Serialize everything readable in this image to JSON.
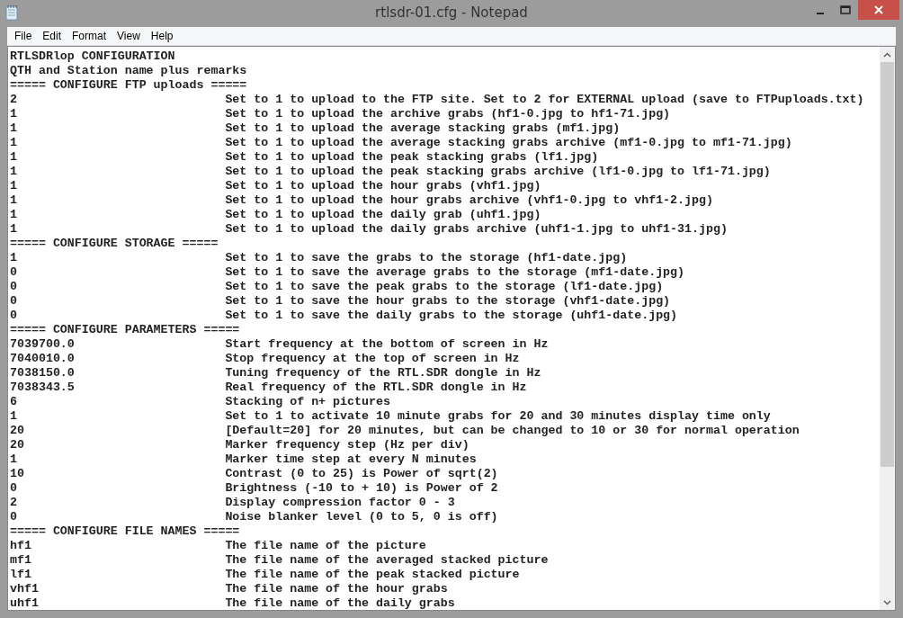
{
  "window": {
    "title": "rtlsdr-01.cfg - Notepad"
  },
  "menu": [
    "File",
    "Edit",
    "Format",
    "View",
    "Help"
  ],
  "lines": [
    {
      "kind": "text",
      "text": "RTLSDRlop CONFIGURATION"
    },
    {
      "kind": "text",
      "text": "QTH and Station name plus remarks"
    },
    {
      "kind": "text",
      "text": "===== CONFIGURE FTP uploads ====="
    },
    {
      "kind": "setting",
      "value": "2",
      "description": "Set to 1 to upload to the FTP site. Set to 2 for EXTERNAL upload (save to FTPuploads.txt)"
    },
    {
      "kind": "setting",
      "value": "1",
      "description": "Set to 1 to upload the archive grabs (hf1-0.jpg to hf1-71.jpg)"
    },
    {
      "kind": "setting",
      "value": "1",
      "description": "Set to 1 to upload the average stacking grabs (mf1.jpg)"
    },
    {
      "kind": "setting",
      "value": "1",
      "description": "Set to 1 to upload the average stacking grabs archive (mf1-0.jpg to mf1-71.jpg)"
    },
    {
      "kind": "setting",
      "value": "1",
      "description": "Set to 1 to upload the peak stacking grabs (lf1.jpg)"
    },
    {
      "kind": "setting",
      "value": "1",
      "description": "Set to 1 to upload the peak stacking grabs archive (lf1-0.jpg to lf1-71.jpg)"
    },
    {
      "kind": "setting",
      "value": "1",
      "description": "Set to 1 to upload the hour grabs (vhf1.jpg)"
    },
    {
      "kind": "setting",
      "value": "1",
      "description": "Set to 1 to upload the hour grabs archive (vhf1-0.jpg to vhf1-2.jpg)"
    },
    {
      "kind": "setting",
      "value": "1",
      "description": "Set to 1 to upload the daily grab (uhf1.jpg)"
    },
    {
      "kind": "setting",
      "value": "1",
      "description": "Set to 1 to upload the daily grabs archive (uhf1-1.jpg to uhf1-31.jpg)"
    },
    {
      "kind": "text",
      "text": "===== CONFIGURE STORAGE ====="
    },
    {
      "kind": "setting",
      "value": "1",
      "description": "Set to 1 to save the grabs to the storage (hf1-date.jpg)"
    },
    {
      "kind": "setting",
      "value": "0",
      "description": "Set to 1 to save the average grabs to the storage (mf1-date.jpg)"
    },
    {
      "kind": "setting",
      "value": "0",
      "description": "Set to 1 to save the peak grabs to the storage (lf1-date.jpg)"
    },
    {
      "kind": "setting",
      "value": "0",
      "description": "Set to 1 to save the hour grabs to the storage (vhf1-date.jpg)"
    },
    {
      "kind": "setting",
      "value": "0",
      "description": "Set to 1 to save the daily grabs to the storage (uhf1-date.jpg)"
    },
    {
      "kind": "text",
      "text": "===== CONFIGURE PARAMETERS ====="
    },
    {
      "kind": "setting",
      "value": "7039700.0",
      "description": "Start frequency at the bottom of screen in Hz"
    },
    {
      "kind": "setting",
      "value": "7040010.0",
      "description": "Stop frequency at the top of screen in Hz"
    },
    {
      "kind": "setting",
      "value": "7038150.0",
      "description": "Tuning frequency of the RTL.SDR dongle in Hz"
    },
    {
      "kind": "setting",
      "value": "7038343.5",
      "description": "Real frequency of the RTL.SDR dongle in Hz"
    },
    {
      "kind": "setting",
      "value": "6",
      "description": "Stacking of n+ pictures"
    },
    {
      "kind": "setting",
      "value": "1",
      "description": "Set to 1 to activate 10 minute grabs for 20 and 30 minutes display time only"
    },
    {
      "kind": "setting",
      "value": "20",
      "description": "[Default=20] for 20 minutes, but can be changed to 10 or 30 for normal operation"
    },
    {
      "kind": "setting",
      "value": "20",
      "description": "Marker frequency step (Hz per div)"
    },
    {
      "kind": "setting",
      "value": "1",
      "description": "Marker time step at every N minutes"
    },
    {
      "kind": "setting",
      "value": "10",
      "description": "Contrast (0 to 25) is Power of sqrt(2)"
    },
    {
      "kind": "setting",
      "value": "0",
      "description": "Brightness (-10 to + 10) is Power of 2"
    },
    {
      "kind": "setting",
      "value": "2",
      "description": "Display compression factor 0 - 3"
    },
    {
      "kind": "setting",
      "value": "0",
      "description": "Noise blanker level (0 to 5, 0 is off)"
    },
    {
      "kind": "text",
      "text": "===== CONFIGURE FILE NAMES ====="
    },
    {
      "kind": "setting",
      "value": "hf1",
      "description": "The file name of the picture"
    },
    {
      "kind": "setting",
      "value": "mf1",
      "description": "The file name of the averaged stacked picture"
    },
    {
      "kind": "setting",
      "value": "lf1",
      "description": "The file name of the peak stacked picture"
    },
    {
      "kind": "setting",
      "value": "vhf1",
      "description": "The file name of the hour grabs"
    },
    {
      "kind": "setting",
      "value": "uhf1",
      "description": "The file name of the daily grabs"
    }
  ]
}
